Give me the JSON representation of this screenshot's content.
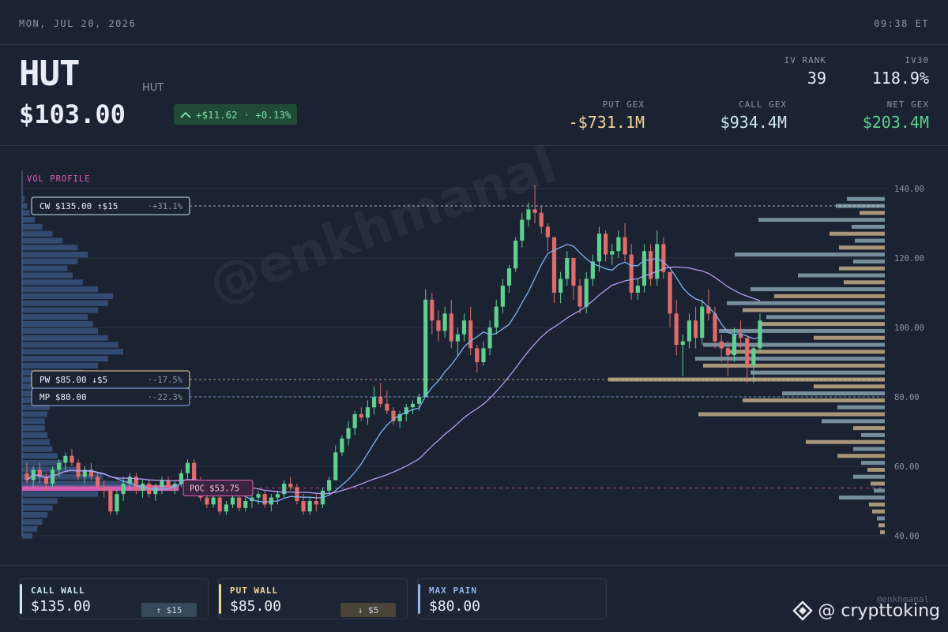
{
  "topbar": {
    "date": "MON, JUL 20, 2026",
    "time": "09:38 ET"
  },
  "header": {
    "ticker": "HUT",
    "subticker": "HUT",
    "price": "$103.00",
    "change": "+$11.62 · +0.13%",
    "iv_rank_label": "IV RANK",
    "iv_rank": "39",
    "iv30_label": "IV30",
    "iv30": "118.9%",
    "put_gex_label": "PUT GEX",
    "put_gex": "-$731.1M",
    "call_gex_label": "CALL GEX",
    "call_gex": "$934.4M",
    "net_gex_label": "NET GEX",
    "net_gex": "$203.4M"
  },
  "colors": {
    "up": "#5fd08f",
    "down": "#e06b6b",
    "call": "#cde8ef",
    "put": "#f0d59a",
    "maxpain": "#8fb4f0",
    "poc": "#e060b8",
    "ma_fast": "#7fb2f0",
    "ma_slow": "#b59cf0",
    "vp_bar": "#3c5a86"
  },
  "chart_data": {
    "type": "candlestick",
    "y_ticks": [
      "140.00",
      "120.00",
      "100.00",
      "80.00",
      "60.00",
      "40.00"
    ],
    "ylim": [
      40,
      145
    ],
    "vol_profile_label": "VOL PROFILE",
    "levels": [
      {
        "key": "cw",
        "label": "CW $135.00 ↑$15",
        "pct": "+31.1%",
        "price": 135,
        "color": "#cde8ef"
      },
      {
        "key": "pw",
        "label": "PW $85.00 ↓$5",
        "pct": "-17.5%",
        "price": 85,
        "color": "#f0d59a"
      },
      {
        "key": "mp",
        "label": "MP $80.00",
        "pct": "-22.3%",
        "price": 80,
        "color": "#8fb4f0"
      }
    ],
    "poc": {
      "label": "POC $53.75",
      "price": 53.75
    },
    "candles": [
      [
        58,
        61,
        55,
        56
      ],
      [
        56,
        60,
        54,
        59
      ],
      [
        59,
        61,
        55,
        57
      ],
      [
        57,
        58,
        53,
        55
      ],
      [
        55,
        60,
        54,
        59
      ],
      [
        59,
        62,
        57,
        61
      ],
      [
        61,
        64,
        59,
        63
      ],
      [
        63,
        65,
        60,
        61
      ],
      [
        61,
        62,
        56,
        57
      ],
      [
        57,
        60,
        55,
        59
      ],
      [
        59,
        61,
        56,
        57
      ],
      [
        57,
        58,
        53,
        54
      ],
      [
        54,
        56,
        51,
        53
      ],
      [
        53,
        54,
        46,
        47
      ],
      [
        47,
        53,
        46,
        52
      ],
      [
        52,
        57,
        50,
        55
      ],
      [
        55,
        58,
        53,
        57
      ],
      [
        57,
        58,
        52,
        53
      ],
      [
        53,
        56,
        51,
        55
      ],
      [
        55,
        56,
        51,
        52
      ],
      [
        52,
        55,
        50,
        54
      ],
      [
        54,
        57,
        52,
        56
      ],
      [
        56,
        57,
        53,
        54
      ],
      [
        54,
        56,
        52,
        55
      ],
      [
        55,
        59,
        54,
        58
      ],
      [
        58,
        62,
        56,
        61
      ],
      [
        61,
        62,
        55,
        56
      ],
      [
        56,
        57,
        50,
        51
      ],
      [
        51,
        53,
        48,
        49
      ],
      [
        49,
        52,
        48,
        51
      ],
      [
        51,
        52,
        46,
        47
      ],
      [
        47,
        50,
        46,
        49
      ],
      [
        49,
        52,
        48,
        51
      ],
      [
        51,
        52,
        47,
        48
      ],
      [
        48,
        51,
        47,
        50
      ],
      [
        50,
        52,
        48,
        51
      ],
      [
        51,
        53,
        49,
        52
      ],
      [
        52,
        53,
        48,
        49
      ],
      [
        49,
        52,
        47,
        51
      ],
      [
        51,
        53,
        49,
        52
      ],
      [
        52,
        56,
        51,
        55
      ],
      [
        55,
        57,
        53,
        54
      ],
      [
        54,
        55,
        49,
        50
      ],
      [
        50,
        52,
        46,
        47
      ],
      [
        47,
        51,
        46,
        50
      ],
      [
        50,
        52,
        47,
        49
      ],
      [
        49,
        54,
        48,
        53
      ],
      [
        53,
        57,
        52,
        56
      ],
      [
        56,
        66,
        56,
        64
      ],
      [
        64,
        69,
        63,
        68
      ],
      [
        68,
        73,
        66,
        71
      ],
      [
        71,
        76,
        69,
        75
      ],
      [
        75,
        77,
        73,
        74
      ],
      [
        74,
        79,
        72,
        77
      ],
      [
        77,
        83,
        75,
        80
      ],
      [
        80,
        84,
        77,
        78
      ],
      [
        78,
        82,
        75,
        76
      ],
      [
        76,
        77,
        72,
        73
      ],
      [
        73,
        76,
        71,
        75
      ],
      [
        75,
        78,
        73,
        77
      ],
      [
        77,
        79,
        75,
        78
      ],
      [
        78,
        81,
        76,
        80
      ],
      [
        80,
        111,
        94,
        108
      ],
      [
        108,
        110,
        98,
        102
      ],
      [
        102,
        105,
        96,
        99
      ],
      [
        99,
        106,
        97,
        104
      ],
      [
        104,
        108,
        94,
        96
      ],
      [
        96,
        100,
        92,
        98
      ],
      [
        98,
        104,
        96,
        102
      ],
      [
        102,
        106,
        92,
        94
      ],
      [
        94,
        95,
        87,
        90
      ],
      [
        90,
        96,
        89,
        94
      ],
      [
        94,
        102,
        92,
        100
      ],
      [
        100,
        108,
        98,
        106
      ],
      [
        106,
        114,
        104,
        112
      ],
      [
        112,
        118,
        110,
        117
      ],
      [
        117,
        126,
        116,
        125
      ],
      [
        125,
        133,
        123,
        131
      ],
      [
        131,
        136,
        129,
        134
      ],
      [
        134,
        141,
        130,
        133
      ],
      [
        133,
        135,
        127,
        129
      ],
      [
        129,
        130,
        122,
        126
      ],
      [
        126,
        122,
        107,
        110
      ],
      [
        110,
        116,
        107,
        114
      ],
      [
        114,
        122,
        112,
        120
      ],
      [
        120,
        120,
        108,
        112
      ],
      [
        112,
        114,
        104,
        106
      ],
      [
        106,
        116,
        104,
        114
      ],
      [
        114,
        121,
        112,
        119
      ],
      [
        119,
        129,
        116,
        127
      ],
      [
        127,
        128,
        119,
        121
      ],
      [
        121,
        124,
        118,
        122
      ],
      [
        122,
        128,
        120,
        126
      ],
      [
        126,
        130,
        119,
        121
      ],
      [
        121,
        124,
        108,
        110
      ],
      [
        110,
        114,
        108,
        112
      ],
      [
        112,
        124,
        110,
        122
      ],
      [
        122,
        124,
        112,
        114
      ],
      [
        114,
        128,
        112,
        124
      ],
      [
        124,
        126,
        114,
        116
      ],
      [
        116,
        112,
        100,
        104
      ],
      [
        104,
        108,
        92,
        95
      ],
      [
        95,
        98,
        86,
        96
      ],
      [
        96,
        104,
        94,
        102
      ],
      [
        102,
        106,
        94,
        97
      ],
      [
        97,
        108,
        95,
        106
      ],
      [
        106,
        111,
        102,
        104
      ],
      [
        104,
        106,
        94,
        96
      ],
      [
        96,
        98,
        90,
        94
      ],
      [
        94,
        96,
        86,
        92
      ],
      [
        92,
        100,
        90,
        98
      ],
      [
        98,
        102,
        94,
        97
      ],
      [
        97,
        95,
        84,
        89
      ],
      [
        89,
        95,
        84,
        94
      ],
      [
        94,
        104,
        93,
        102
      ]
    ],
    "profile": [
      [
        40,
        4
      ],
      [
        42,
        6
      ],
      [
        44,
        8
      ],
      [
        46,
        10
      ],
      [
        48,
        12
      ],
      [
        50,
        14
      ],
      [
        52,
        30
      ],
      [
        53.75,
        62
      ],
      [
        55,
        46
      ],
      [
        57,
        32
      ],
      [
        59,
        22
      ],
      [
        61,
        16
      ],
      [
        63,
        14
      ],
      [
        65,
        12
      ],
      [
        67,
        11
      ],
      [
        69,
        10
      ],
      [
        71,
        9
      ],
      [
        73,
        9
      ],
      [
        75,
        10
      ],
      [
        77,
        11
      ],
      [
        79,
        12
      ],
      [
        81,
        14
      ],
      [
        83,
        16
      ],
      [
        85,
        20
      ],
      [
        87,
        24
      ],
      [
        89,
        30
      ],
      [
        91,
        34
      ],
      [
        93,
        40
      ],
      [
        95,
        38
      ],
      [
        97,
        34
      ],
      [
        99,
        30
      ],
      [
        101,
        28
      ],
      [
        103,
        26
      ],
      [
        105,
        30
      ],
      [
        107,
        34
      ],
      [
        109,
        36
      ],
      [
        111,
        30
      ],
      [
        113,
        24
      ],
      [
        115,
        20
      ],
      [
        117,
        18
      ],
      [
        119,
        22
      ],
      [
        121,
        26
      ],
      [
        123,
        22
      ],
      [
        125,
        16
      ],
      [
        127,
        12
      ],
      [
        129,
        8
      ],
      [
        131,
        5
      ],
      [
        133,
        3
      ],
      [
        135,
        2
      ],
      [
        137,
        1
      ]
    ],
    "strike_bars": [
      [
        137,
        48,
        "call"
      ],
      [
        135,
        62,
        "call"
      ],
      [
        133,
        32,
        "put"
      ],
      [
        131,
        160,
        "call"
      ],
      [
        129,
        42,
        "call"
      ],
      [
        127,
        70,
        "put"
      ],
      [
        125,
        38,
        "call"
      ],
      [
        123,
        58,
        "put"
      ],
      [
        121,
        190,
        "call"
      ],
      [
        119,
        40,
        "call"
      ],
      [
        117,
        58,
        "put"
      ],
      [
        115,
        110,
        "call"
      ],
      [
        113,
        52,
        "put"
      ],
      [
        111,
        170,
        "call"
      ],
      [
        109,
        140,
        "put"
      ],
      [
        107,
        200,
        "call"
      ],
      [
        105,
        180,
        "put"
      ],
      [
        103,
        150,
        "call"
      ],
      [
        101,
        160,
        "put"
      ],
      [
        99,
        210,
        "call"
      ],
      [
        97,
        90,
        "put"
      ],
      [
        95,
        230,
        "call"
      ],
      [
        93,
        200,
        "put"
      ],
      [
        91,
        240,
        "call"
      ],
      [
        89,
        230,
        "put"
      ],
      [
        87,
        170,
        "call"
      ],
      [
        85,
        350,
        "put"
      ],
      [
        83,
        90,
        "put"
      ],
      [
        81,
        130,
        "call"
      ],
      [
        79,
        180,
        "put"
      ],
      [
        77,
        60,
        "call"
      ],
      [
        75,
        236,
        "put"
      ],
      [
        73,
        80,
        "call"
      ],
      [
        71,
        40,
        "put"
      ],
      [
        69,
        30,
        "call"
      ],
      [
        67,
        100,
        "put"
      ],
      [
        65,
        40,
        "call"
      ],
      [
        63,
        60,
        "put"
      ],
      [
        61,
        30,
        "call"
      ],
      [
        59,
        22,
        "put"
      ],
      [
        57,
        40,
        "call"
      ],
      [
        55,
        18,
        "put"
      ],
      [
        53,
        14,
        "call"
      ],
      [
        51,
        58,
        "call"
      ],
      [
        49,
        20,
        "put"
      ],
      [
        47,
        16,
        "put"
      ],
      [
        45,
        10,
        "call"
      ],
      [
        43,
        8,
        "put"
      ],
      [
        41,
        6,
        "put"
      ]
    ]
  },
  "cards": [
    {
      "label": "CALL WALL",
      "value": "$135.00",
      "badge": "↑ $15"
    },
    {
      "label": "PUT WALL",
      "value": "$85.00",
      "badge": "↓ $5"
    },
    {
      "label": "MAX PAIN",
      "value": "$80.00"
    }
  ],
  "footer": {
    "handle": "@enkhmanal",
    "brand": "@ crypttoking",
    "watermark": "@enkhmanal"
  }
}
